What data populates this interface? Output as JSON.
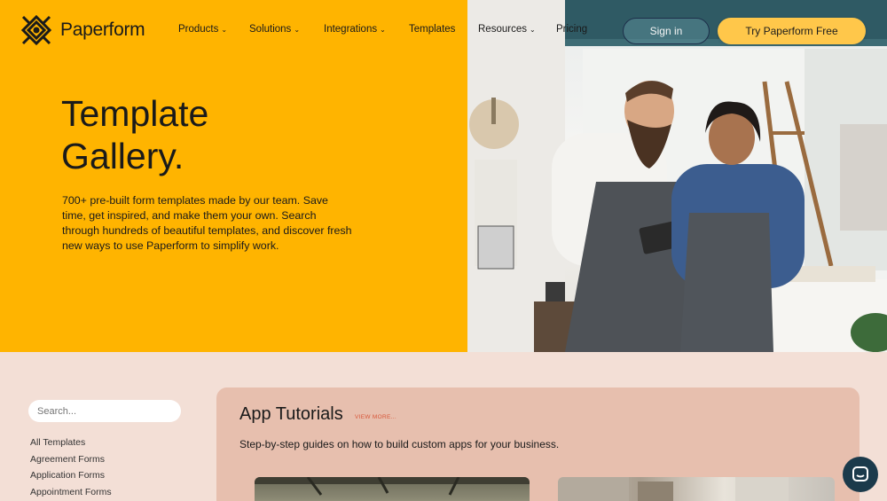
{
  "nav": {
    "logo_text": "Paperform",
    "items": [
      {
        "label": "Products",
        "has_dropdown": true
      },
      {
        "label": "Solutions",
        "has_dropdown": true
      },
      {
        "label": "Integrations",
        "has_dropdown": true
      },
      {
        "label": "Templates",
        "has_dropdown": false
      },
      {
        "label": "Resources",
        "has_dropdown": true
      },
      {
        "label": "Pricing",
        "has_dropdown": false
      }
    ],
    "chevron": "⌄",
    "signin_label": "Sign in",
    "cta_label": "Try Paperform Free"
  },
  "hero": {
    "title_line1": "Template",
    "title_line2": "Gallery.",
    "description": "700+ pre-built form templates made by our team. Save time, get inspired, and make them your own. Search through hundreds of beautiful templates, and discover fresh new ways to use Paperform to simplify work."
  },
  "sidebar": {
    "search_placeholder": "Search...",
    "categories": [
      "All Templates",
      "Agreement Forms",
      "Application Forms",
      "Appointment Forms"
    ]
  },
  "section": {
    "title": "App Tutorials",
    "view_more": "VIEW MORE...",
    "description": "Step-by-step guides on how to build custom apps for your business."
  },
  "icons": {
    "logo": "paperform-logo-icon",
    "chat": "chat-icon"
  },
  "colors": {
    "hero_yellow": "#ffb400",
    "cta_yellow": "#ffc74a",
    "page_bg": "#f3dfd6",
    "card_bg": "#e7bfae",
    "navy": "#1d2f4a",
    "accent_orange": "#d8573a"
  }
}
